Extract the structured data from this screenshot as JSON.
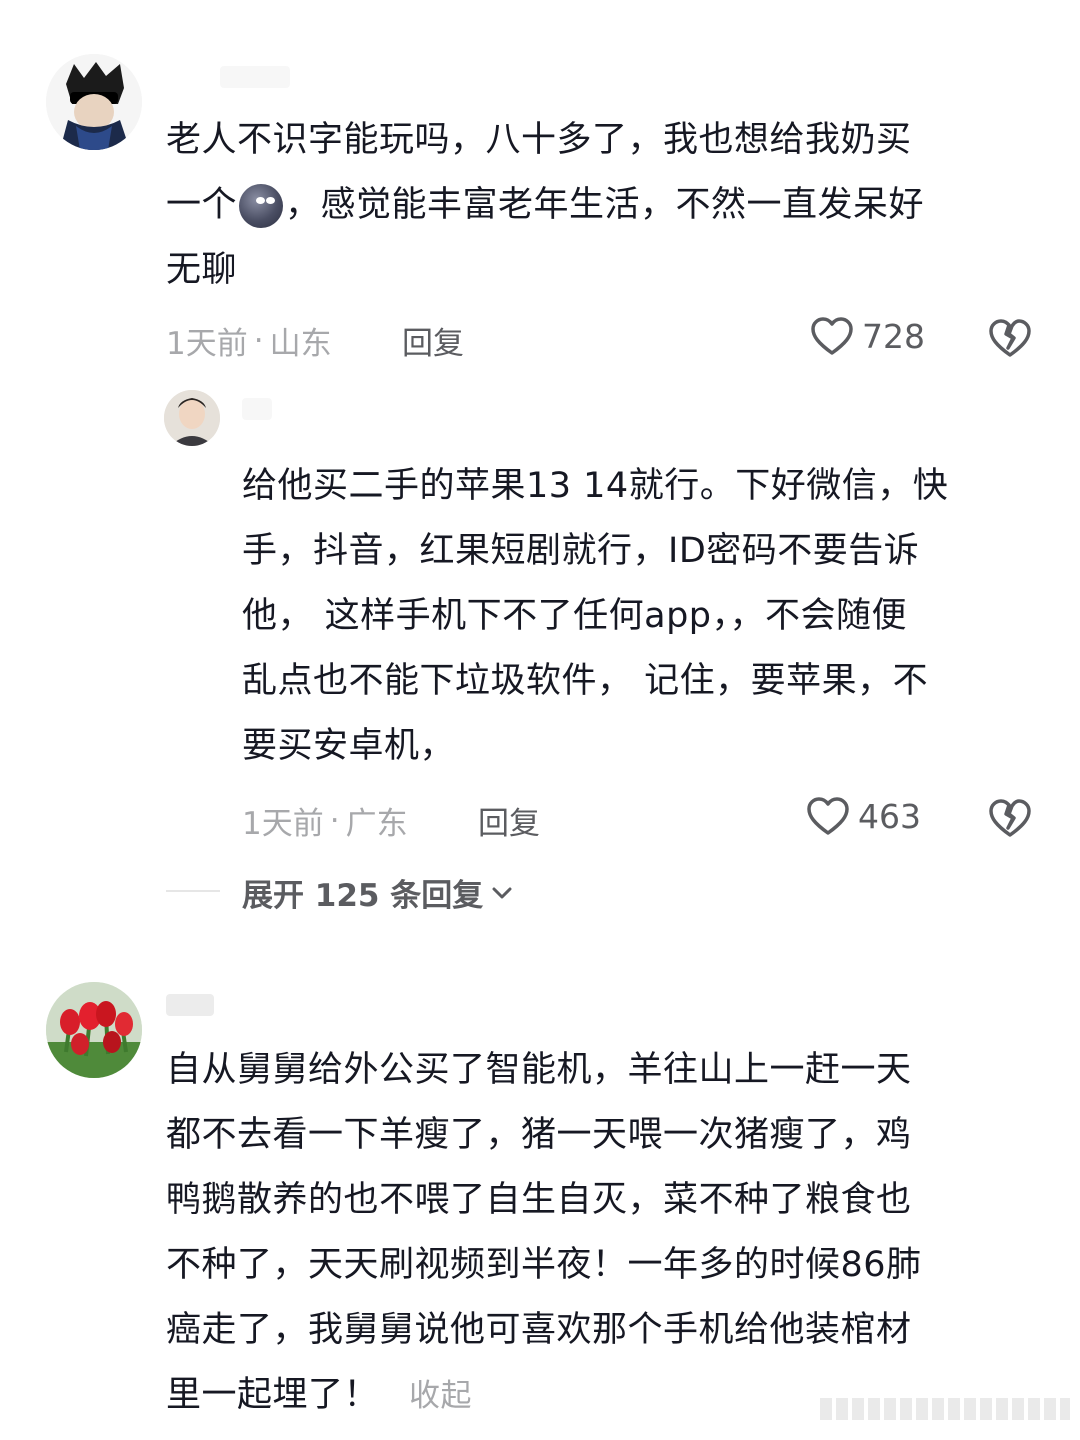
{
  "comments": [
    {
      "text_lines": [
        "老人不识字能玩吗，八十多了，我也想给我奶买",
        "一个",
        "，感觉能丰富老年生活，不然一直发呆好",
        "无聊"
      ],
      "time": "1天前",
      "separator": "·",
      "location": "山东",
      "reply_label": "回复",
      "likes": "728",
      "emoji_icon": "moon-face-icon"
    },
    {
      "text_lines": [
        "给他买二手的苹果13 14就行。下好微信，快",
        "手，抖音，红果短剧就行，ID密码不要告诉",
        "他， 这样手机下不了任何app，，不会随便",
        "乱点也不能下垃圾软件， 记住，要苹果，不",
        "要买安卓机，"
      ],
      "time": "1天前",
      "separator": "·",
      "location": "广东",
      "reply_label": "回复",
      "likes": "463"
    },
    {
      "text_lines": [
        "自从舅舅给外公买了智能机，羊往山上一赶一天",
        "都不去看一下羊瘦了，猪一天喂一次猪瘦了，鸡",
        "鸭鹅散养的也不喂了自生自灭，菜不种了粮食也",
        "不种了，天天刷视频到半夜！一年多的时候86肺",
        "癌走了，我舅舅说他可喜欢那个手机给他装棺材",
        "里一起埋了！"
      ],
      "collapse_label": "收起"
    }
  ],
  "expand_replies": {
    "label": "展开 125 条回复"
  },
  "icons": {
    "like": "heart-outline-icon",
    "dislike": "broken-heart-icon",
    "expand": "chevron-down-icon"
  },
  "colors": {
    "primary_text": "#161823",
    "secondary_text": "#a7a8ab",
    "action_text": "#5b5c60"
  }
}
